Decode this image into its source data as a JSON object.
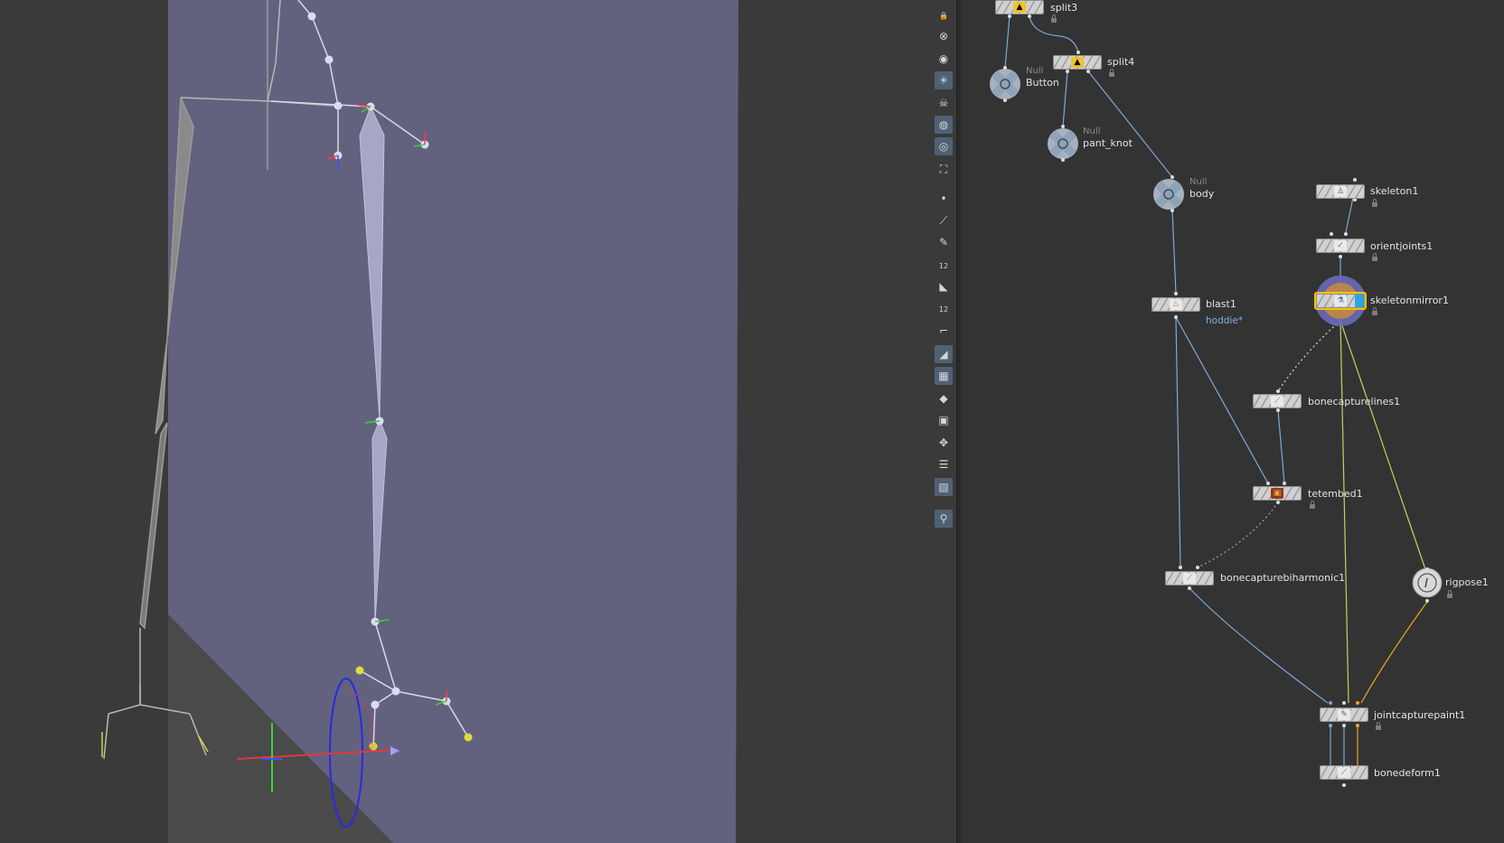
{
  "colors": {
    "viewport_bg": "#3a3a3a",
    "plane": "#62627f",
    "wire": "#7fa7d6",
    "wire_yellow": "#c5cf6a",
    "wire_orange": "#e8a820",
    "selection": "#f5c400"
  },
  "toolbar": {
    "tools": [
      {
        "name": "lock-icon",
        "glyph": "🔒"
      },
      {
        "name": "close-circle-icon",
        "glyph": "⊗"
      },
      {
        "name": "ghost-icon",
        "glyph": "◉"
      },
      {
        "name": "light-bulb-icon",
        "glyph": "☀"
      },
      {
        "name": "skull-icon",
        "glyph": "☠"
      },
      {
        "name": "shading-icon",
        "glyph": "◍"
      },
      {
        "name": "camera-eye-icon",
        "glyph": "◎"
      },
      {
        "name": "camera-icon",
        "glyph": "⛶"
      },
      {
        "name": "point-icon",
        "glyph": "•"
      },
      {
        "name": "edge-icon",
        "glyph": "⟋"
      },
      {
        "name": "brush-icon",
        "glyph": "✎"
      },
      {
        "name": "point-number-icon",
        "glyph": "12"
      },
      {
        "name": "primitive-icon",
        "glyph": "◣"
      },
      {
        "name": "primitive-number-icon",
        "glyph": "12"
      },
      {
        "name": "normal-icon",
        "glyph": "⌐"
      },
      {
        "name": "wireframe-icon",
        "glyph": "◢"
      },
      {
        "name": "texture-icon",
        "glyph": "▦"
      },
      {
        "name": "diamond-icon",
        "glyph": "◆"
      },
      {
        "name": "uv-icon",
        "glyph": "▣"
      },
      {
        "name": "axes-icon",
        "glyph": "✥"
      },
      {
        "name": "display-list-icon",
        "glyph": "☰"
      },
      {
        "name": "background-image-icon",
        "glyph": "▧"
      },
      {
        "name": "pin-icon",
        "glyph": "⚲"
      }
    ]
  },
  "network": {
    "nodes": {
      "split3": {
        "label": "split3",
        "type": "split"
      },
      "split4": {
        "label": "split4",
        "type": "split"
      },
      "button": {
        "label": "Button",
        "type_label": "Null"
      },
      "pant_knot": {
        "label": "pant_knot",
        "type_label": "Null"
      },
      "body": {
        "label": "body",
        "type_label": "Null"
      },
      "skeleton1": {
        "label": "skeleton1"
      },
      "orientjoints1": {
        "label": "orientjoints1"
      },
      "skeletonmirror1": {
        "label": "skeletonmirror1"
      },
      "blast1": {
        "label": "blast1",
        "comment": "hoddie*"
      },
      "bonecapturelines1": {
        "label": "bonecapturelines1"
      },
      "tetembed1": {
        "label": "tetembed1"
      },
      "bonecapturebiharmonic1": {
        "label": "bonecapturebiharmonic1"
      },
      "rigpose1": {
        "label": "rigpose1"
      },
      "jointcapturepaint1": {
        "label": "jointcapturepaint1"
      },
      "bonedeform1": {
        "label": "bonedeform1"
      }
    }
  }
}
